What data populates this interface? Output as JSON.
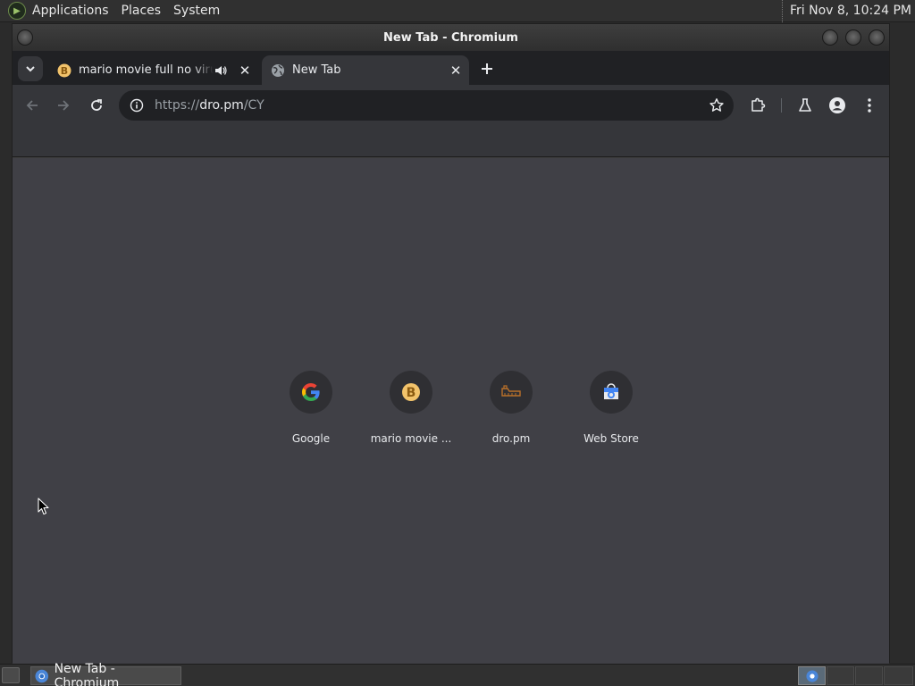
{
  "top_panel": {
    "menus": [
      "Applications",
      "Places",
      "System"
    ],
    "clock": "Fri Nov  8, 10:24 PM"
  },
  "window": {
    "title": "New Tab - Chromium"
  },
  "tabs": [
    {
      "title": "mario movie full no virus",
      "active": false,
      "audio": true
    },
    {
      "title": "New Tab",
      "active": true,
      "audio": false
    }
  ],
  "omnibox": {
    "url_scheme": "https://",
    "url_host": "dro.pm",
    "url_path": "/CY"
  },
  "shortcuts": [
    {
      "label": "Google",
      "icon": "google-icon"
    },
    {
      "label": "mario movie ...",
      "icon": "bitcoin-icon"
    },
    {
      "label": "dro.pm",
      "icon": "dro-pm-icon"
    },
    {
      "label": "Web Store",
      "icon": "web-store-icon"
    }
  ],
  "taskbar": {
    "task_label": "New Tab - Chromium"
  },
  "colors": {
    "content_bg": "#404046",
    "toolbar_bg": "#35363a",
    "tabstrip_bg": "#202124",
    "accent_blue": "#4285f4"
  }
}
